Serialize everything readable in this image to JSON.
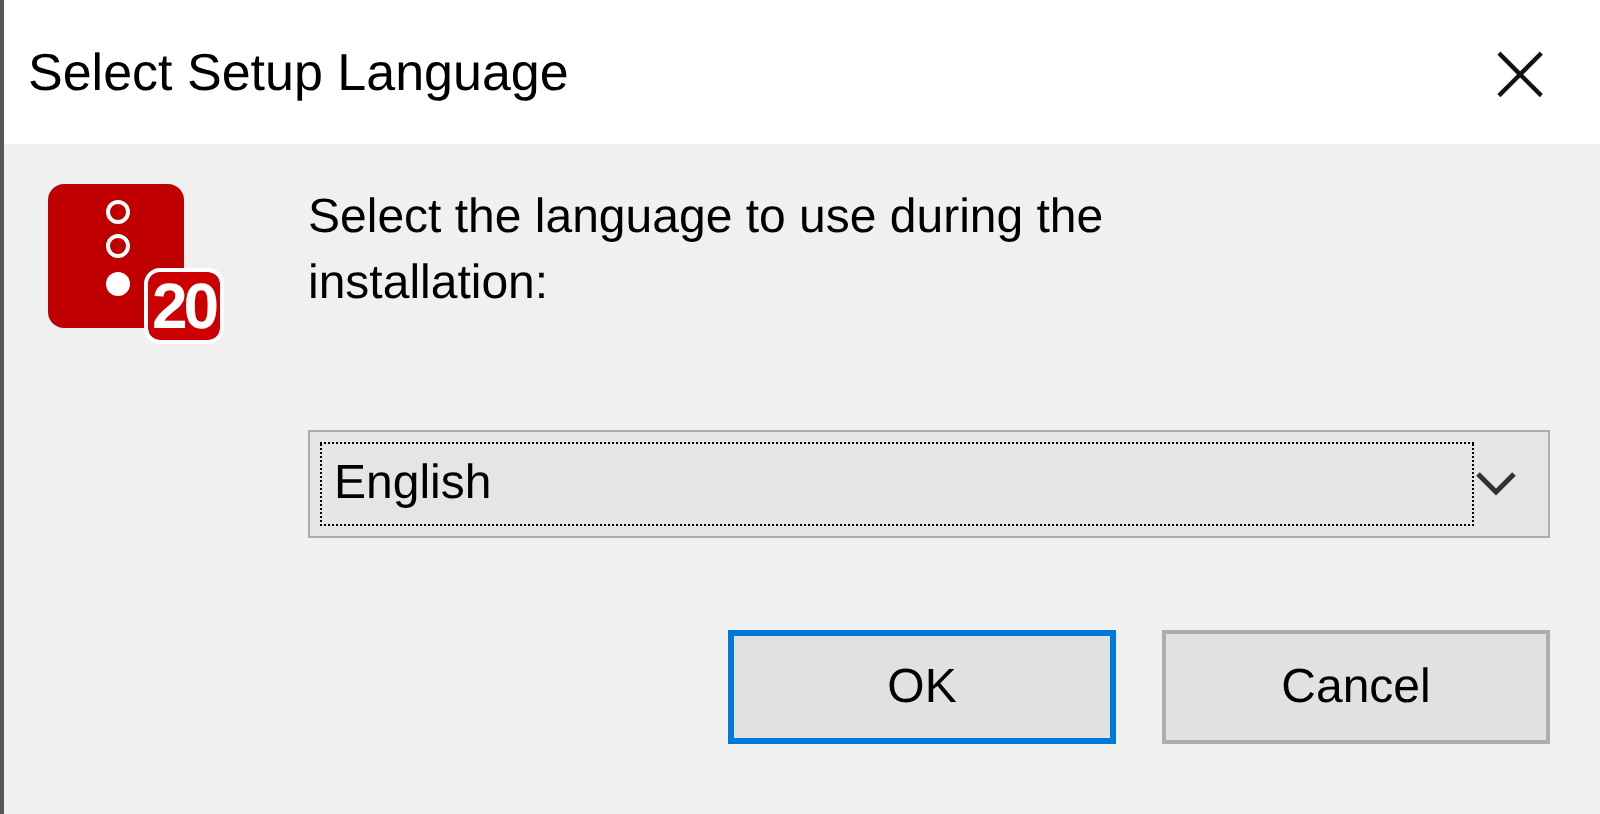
{
  "window": {
    "title": "Select Setup Language",
    "close": "×"
  },
  "icon": {
    "badge": "20"
  },
  "prompt": "Select the language to use during the installation:",
  "language_select": {
    "value": "English"
  },
  "buttons": [
    {
      "label": "OK",
      "selected": true
    },
    {
      "label": "Cancel",
      "selected": false
    }
  ]
}
